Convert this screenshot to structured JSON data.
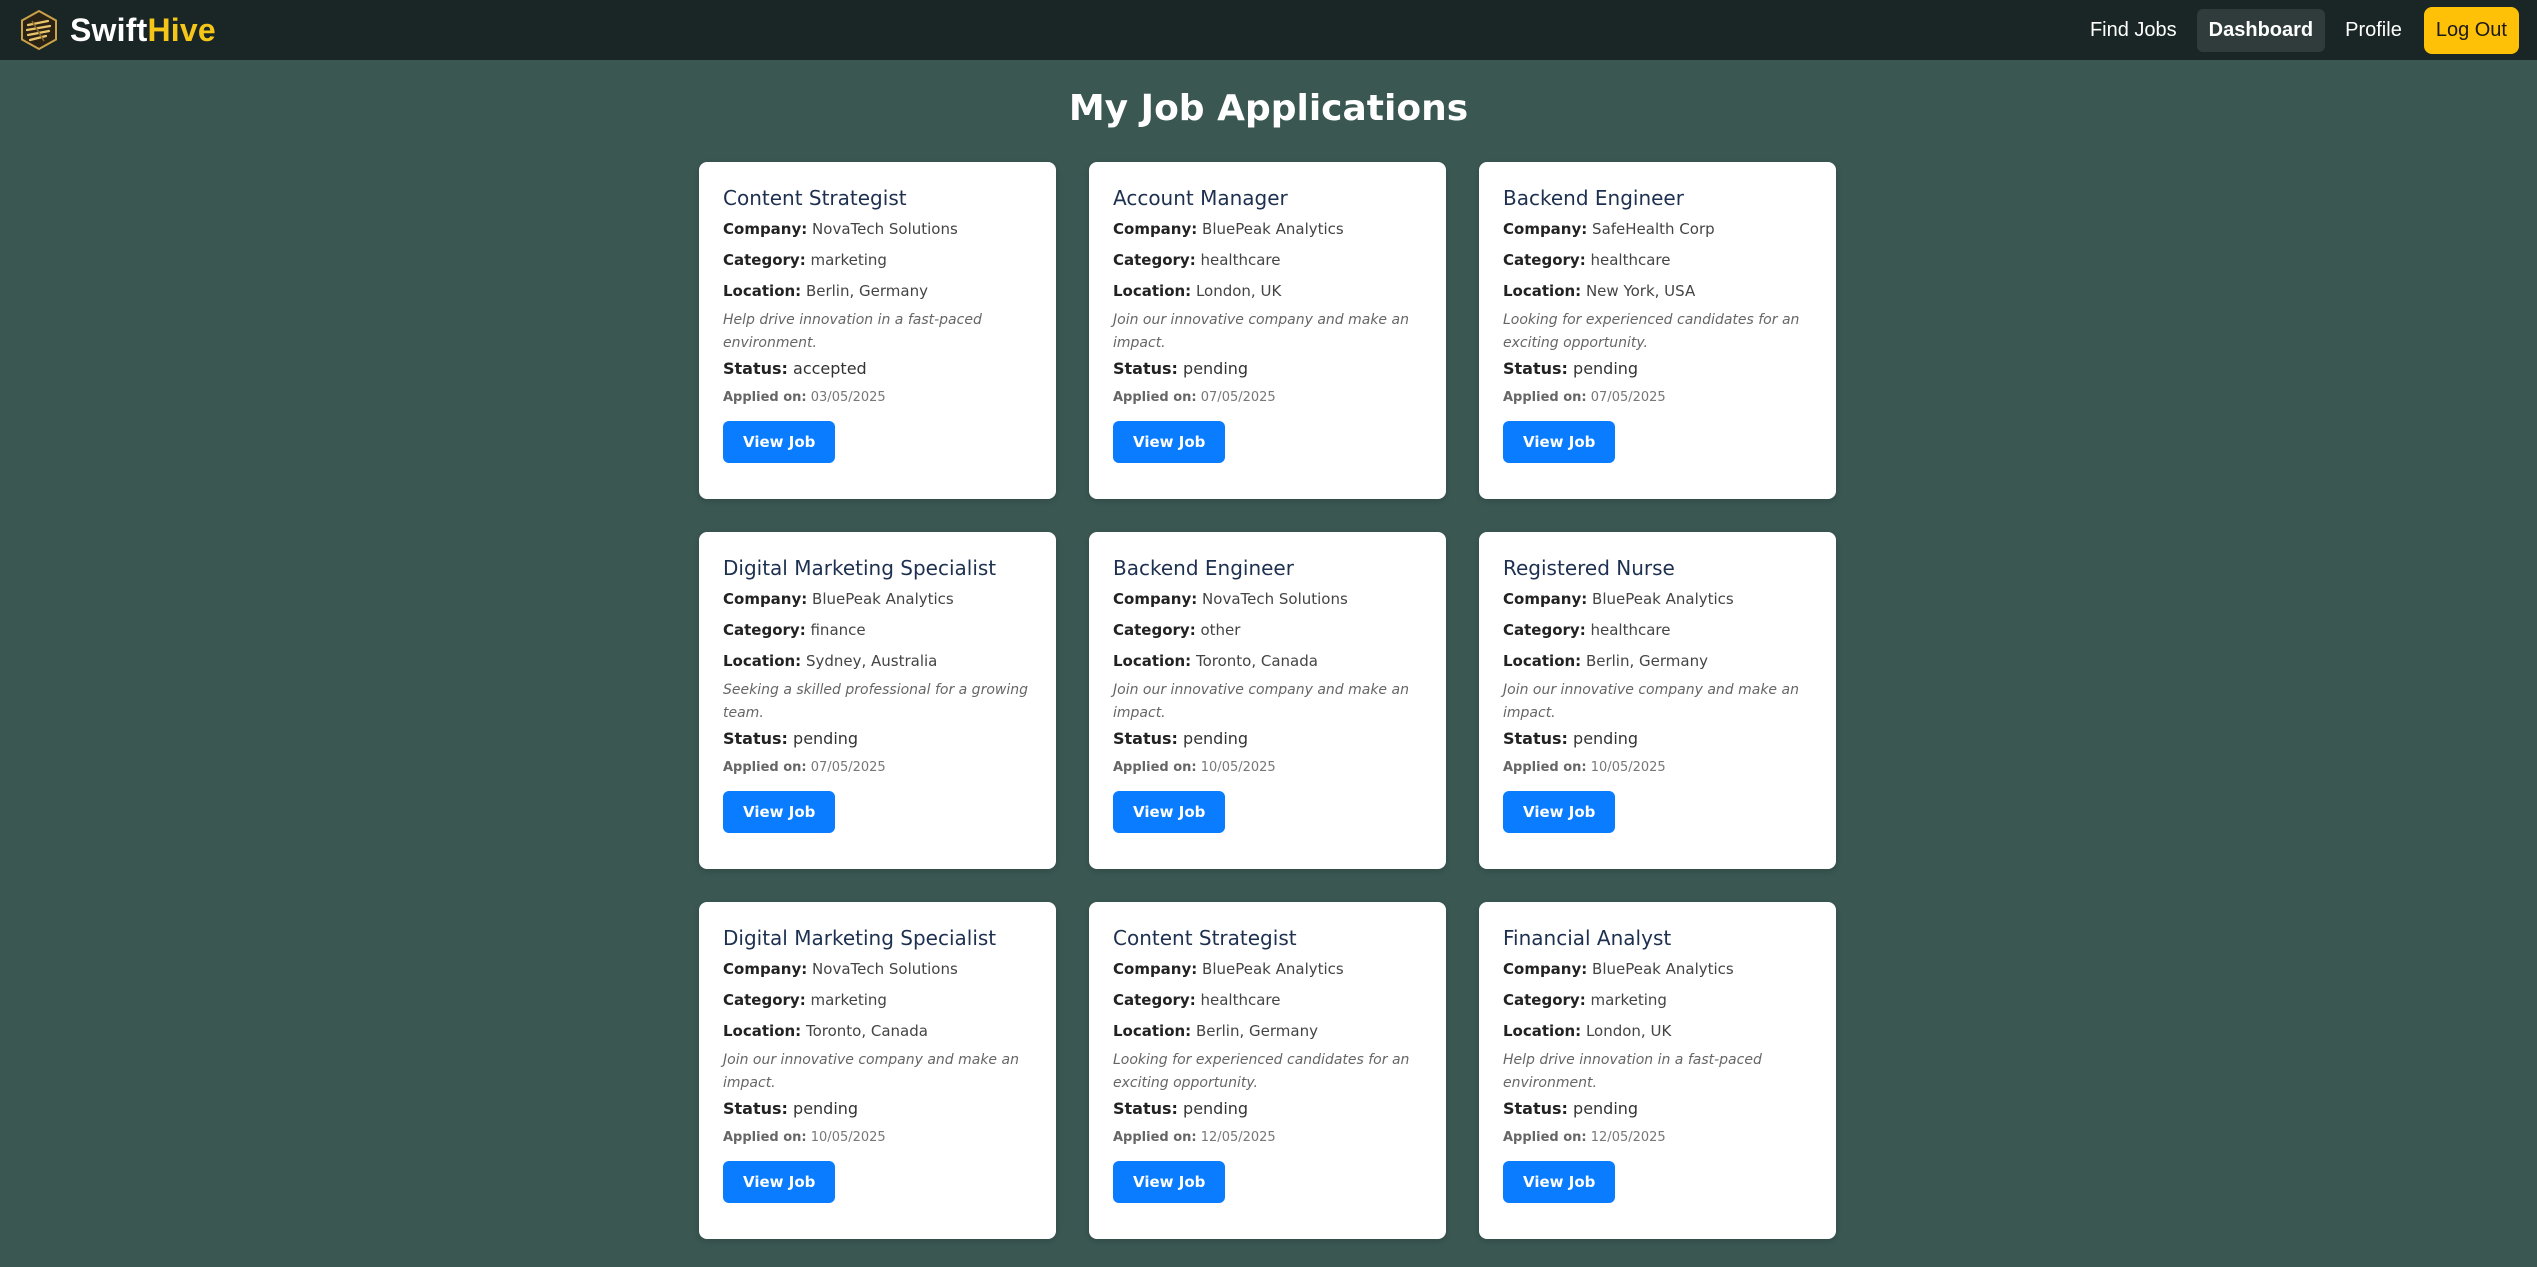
{
  "brand": {
    "part1": "Swift",
    "part2": "Hive",
    "logo_icon": "hexagon-hive-logo"
  },
  "nav": {
    "find_jobs": "Find Jobs",
    "dashboard": "Dashboard",
    "profile": "Profile",
    "logout": "Log Out"
  },
  "page": {
    "title": "My Job Applications"
  },
  "labels": {
    "company": "Company:",
    "category": "Category:",
    "location": "Location:",
    "status": "Status:",
    "applied_on": "Applied on:",
    "view_job": "View Job"
  },
  "colors": {
    "accent": "#0a7cff",
    "brand_highlight": "#f5c518",
    "background": "#3a5752"
  },
  "applications": [
    {
      "title": "Content Strategist",
      "company": "NovaTech Solutions",
      "category": "marketing",
      "location": "Berlin, Germany",
      "description": "Help drive innovation in a fast-paced environment.",
      "status": "accepted",
      "applied_on": "03/05/2025"
    },
    {
      "title": "Account Manager",
      "company": "BluePeak Analytics",
      "category": "healthcare",
      "location": "London, UK",
      "description": "Join our innovative company and make an impact.",
      "status": "pending",
      "applied_on": "07/05/2025"
    },
    {
      "title": "Backend Engineer",
      "company": "SafeHealth Corp",
      "category": "healthcare",
      "location": "New York, USA",
      "description": "Looking for experienced candidates for an exciting opportunity.",
      "status": "pending",
      "applied_on": "07/05/2025"
    },
    {
      "title": "Digital Marketing Specialist",
      "company": "BluePeak Analytics",
      "category": "finance",
      "location": "Sydney, Australia",
      "description": "Seeking a skilled professional for a growing team.",
      "status": "pending",
      "applied_on": "07/05/2025"
    },
    {
      "title": "Backend Engineer",
      "company": "NovaTech Solutions",
      "category": "other",
      "location": "Toronto, Canada",
      "description": "Join our innovative company and make an impact.",
      "status": "pending",
      "applied_on": "10/05/2025"
    },
    {
      "title": "Registered Nurse",
      "company": "BluePeak Analytics",
      "category": "healthcare",
      "location": "Berlin, Germany",
      "description": "Join our innovative company and make an impact.",
      "status": "pending",
      "applied_on": "10/05/2025"
    },
    {
      "title": "Digital Marketing Specialist",
      "company": "NovaTech Solutions",
      "category": "marketing",
      "location": "Toronto, Canada",
      "description": "Join our innovative company and make an impact.",
      "status": "pending",
      "applied_on": "10/05/2025"
    },
    {
      "title": "Content Strategist",
      "company": "BluePeak Analytics",
      "category": "healthcare",
      "location": "Berlin, Germany",
      "description": "Looking for experienced candidates for an exciting opportunity.",
      "status": "pending",
      "applied_on": "12/05/2025"
    },
    {
      "title": "Financial Analyst",
      "company": "BluePeak Analytics",
      "category": "marketing",
      "location": "London, UK",
      "description": "Help drive innovation in a fast-paced environment.",
      "status": "pending",
      "applied_on": "12/05/2025"
    }
  ]
}
